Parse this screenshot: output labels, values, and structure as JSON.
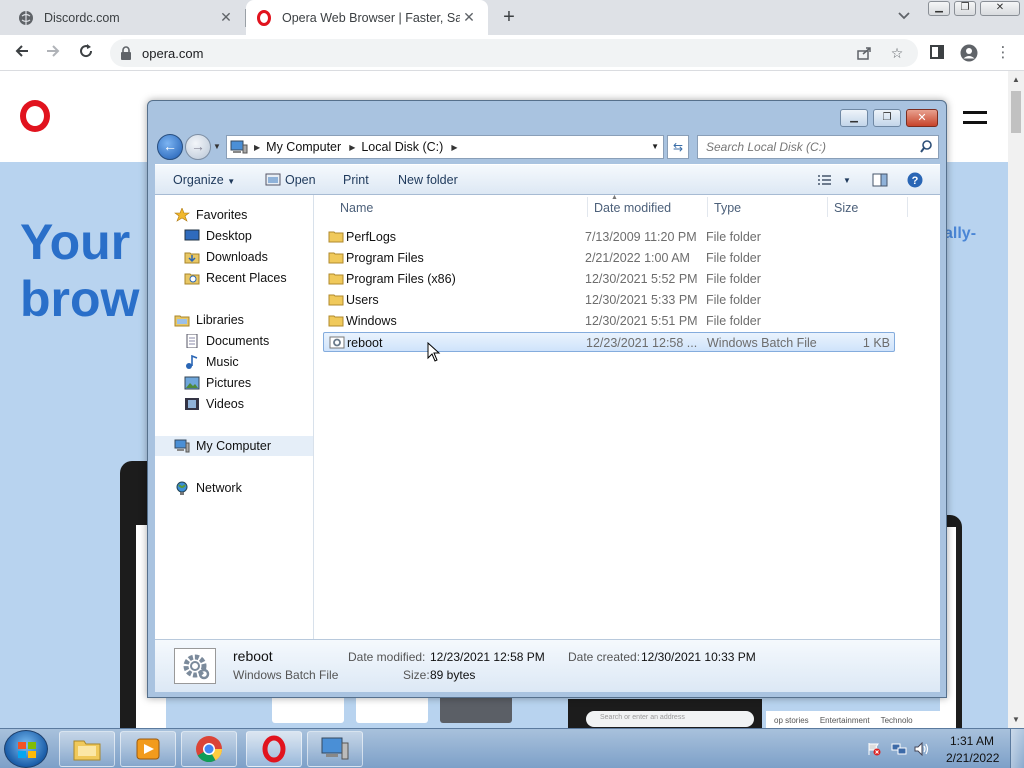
{
  "browser": {
    "tabs": [
      {
        "title": "Discordc.com"
      },
      {
        "title": "Opera Web Browser | Faster, Safe"
      }
    ],
    "url": "opera.com"
  },
  "page": {
    "hero_line1": "Your",
    "hero_line2": "brow",
    "hero_right": "ally-",
    "laptop_search": "Search or enter an address",
    "strip_items": [
      "op stories",
      "Entertainment",
      "Technolo"
    ]
  },
  "explorer": {
    "breadcrumb": [
      "My Computer",
      "Local Disk (C:)"
    ],
    "search_placeholder": "Search Local Disk (C:)",
    "commands": {
      "organize": "Organize",
      "open": "Open",
      "print": "Print",
      "new_folder": "New folder"
    },
    "nav": {
      "favorites": "Favorites",
      "desktop": "Desktop",
      "downloads": "Downloads",
      "recent": "Recent Places",
      "libraries": "Libraries",
      "documents": "Documents",
      "music": "Music",
      "pictures": "Pictures",
      "videos": "Videos",
      "my_computer": "My Computer",
      "network": "Network"
    },
    "columns": {
      "name": "Name",
      "date": "Date modified",
      "type": "Type",
      "size": "Size"
    },
    "files": [
      {
        "name": "PerfLogs",
        "date": "7/13/2009 11:20 PM",
        "type": "File folder",
        "size": ""
      },
      {
        "name": "Program Files",
        "date": "2/21/2022 1:00 AM",
        "type": "File folder",
        "size": ""
      },
      {
        "name": "Program Files (x86)",
        "date": "12/30/2021 5:52 PM",
        "type": "File folder",
        "size": ""
      },
      {
        "name": "Users",
        "date": "12/30/2021 5:33 PM",
        "type": "File folder",
        "size": ""
      },
      {
        "name": "Windows",
        "date": "12/30/2021 5:51 PM",
        "type": "File folder",
        "size": ""
      },
      {
        "name": "reboot",
        "date": "12/23/2021 12:58 ...",
        "type": "Windows Batch File",
        "size": "1 KB"
      }
    ],
    "details": {
      "name": "reboot",
      "type": "Windows Batch File",
      "modified_label": "Date modified:",
      "modified": "12/23/2021 12:58 PM",
      "created_label": "Date created:",
      "created": "12/30/2021 10:33 PM",
      "size_label": "Size:",
      "size": "89 bytes"
    }
  },
  "taskbar": {
    "time": "1:31 AM",
    "date": "2/21/2022"
  },
  "colors": {
    "opera_red": "#e1131e",
    "hero_blue": "#2a6fc9",
    "hero_bg": "#b8d3ef",
    "selection": "#cfe3fb"
  }
}
